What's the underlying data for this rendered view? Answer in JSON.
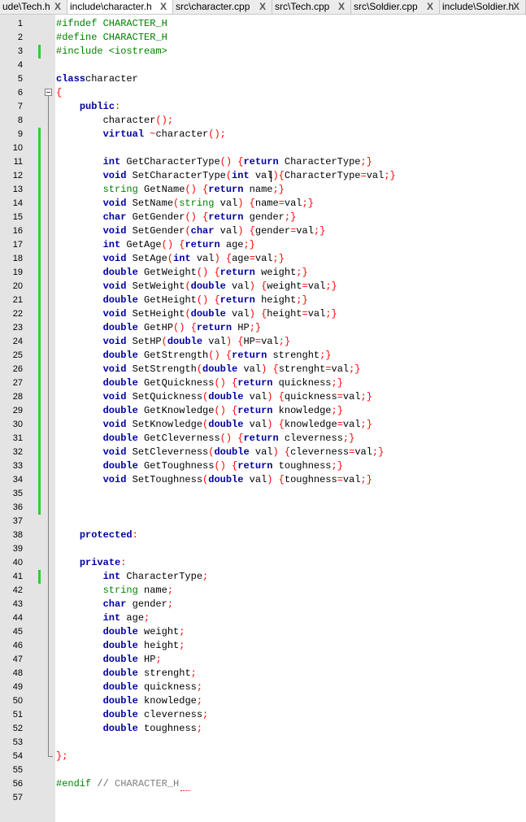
{
  "tabs": [
    {
      "label": "ude\\Tech.h",
      "active": false
    },
    {
      "label": "include\\character.h",
      "active": true
    },
    {
      "label": "src\\character.cpp",
      "active": false
    },
    {
      "label": "src\\Tech.cpp",
      "active": false
    },
    {
      "label": "src\\Soldier.cpp",
      "active": false
    },
    {
      "label": "include\\Soldier.h",
      "active": false
    }
  ],
  "tab_close_glyph": "X",
  "colors": {
    "keyword": "#0000a0",
    "type": "#008000",
    "preprocessor": "#008000",
    "brace": "#ff0000",
    "comment": "#808080",
    "change_marker": "#33cc33",
    "gutter_bg": "#e4e4e4"
  },
  "changed_lines": [
    3,
    9,
    10,
    11,
    12,
    13,
    14,
    15,
    16,
    17,
    18,
    19,
    20,
    21,
    22,
    23,
    24,
    25,
    26,
    27,
    28,
    29,
    30,
    31,
    32,
    33,
    34,
    35,
    36,
    41
  ],
  "lines": [
    {
      "n": "1",
      "tokens": [
        [
          "pre",
          "#ifndef CHARACTER_H"
        ]
      ]
    },
    {
      "n": "2",
      "tokens": [
        [
          "pre",
          "#define CHARACTER_H"
        ]
      ]
    },
    {
      "n": "3",
      "tokens": [
        [
          "pre",
          "#include <iostream>"
        ]
      ]
    },
    {
      "n": "4",
      "tokens": []
    },
    {
      "n": "5",
      "tokens": [
        [
          "kw",
          "class"
        ],
        [
          "",
          "character"
        ]
      ]
    },
    {
      "n": "6",
      "tokens": [
        [
          "br",
          "{"
        ]
      ]
    },
    {
      "n": "7",
      "tokens": [
        [
          "",
          "    "
        ],
        [
          "kw",
          "public"
        ],
        [
          "op",
          ":"
        ]
      ]
    },
    {
      "n": "8",
      "tokens": [
        [
          "",
          "        character"
        ],
        [
          "op",
          "();"
        ]
      ]
    },
    {
      "n": "9",
      "tokens": [
        [
          "",
          "        "
        ],
        [
          "kw",
          "virtual"
        ],
        [
          "op",
          " ~"
        ],
        [
          "",
          "character"
        ],
        [
          "op",
          "();"
        ]
      ]
    },
    {
      "n": "10",
      "tokens": []
    },
    {
      "n": "11",
      "tokens": [
        [
          "",
          "        "
        ],
        [
          "kw",
          "int"
        ],
        [
          "",
          " GetCharacterType"
        ],
        [
          "op",
          "() {"
        ],
        [
          "kw",
          "return"
        ],
        [
          "",
          " CharacterType"
        ],
        [
          "op",
          ";}"
        ]
      ]
    },
    {
      "n": "12",
      "tokens": [
        [
          "",
          "        "
        ],
        [
          "kw",
          "void"
        ],
        [
          "",
          " SetCharacterType"
        ],
        [
          "op",
          "("
        ],
        [
          "kw",
          "int"
        ],
        [
          "",
          " val"
        ],
        [
          "op",
          ")"
        ],
        [
          "op",
          "{"
        ],
        [
          "",
          "CharacterType"
        ],
        [
          "op",
          "="
        ],
        [
          "",
          "val"
        ],
        [
          "op",
          ";}"
        ]
      ]
    },
    {
      "n": "13",
      "tokens": [
        [
          "",
          "        "
        ],
        [
          "ty",
          "string"
        ],
        [
          "",
          " GetName"
        ],
        [
          "op",
          "() {"
        ],
        [
          "kw",
          "return"
        ],
        [
          "",
          " name"
        ],
        [
          "op",
          ";}"
        ]
      ]
    },
    {
      "n": "14",
      "tokens": [
        [
          "",
          "        "
        ],
        [
          "kw",
          "void"
        ],
        [
          "",
          " SetName"
        ],
        [
          "op",
          "("
        ],
        [
          "ty",
          "string"
        ],
        [
          "",
          " val"
        ],
        [
          "op",
          ") {"
        ],
        [
          "",
          "name"
        ],
        [
          "op",
          "="
        ],
        [
          "",
          "val"
        ],
        [
          "op",
          ";}"
        ]
      ]
    },
    {
      "n": "15",
      "tokens": [
        [
          "",
          "        "
        ],
        [
          "kw",
          "char"
        ],
        [
          "",
          " GetGender"
        ],
        [
          "op",
          "() {"
        ],
        [
          "kw",
          "return"
        ],
        [
          "",
          " gender"
        ],
        [
          "op",
          ";}"
        ]
      ]
    },
    {
      "n": "16",
      "tokens": [
        [
          "",
          "        "
        ],
        [
          "kw",
          "void"
        ],
        [
          "",
          " SetGender"
        ],
        [
          "op",
          "("
        ],
        [
          "kw",
          "char"
        ],
        [
          "",
          " val"
        ],
        [
          "op",
          ") {"
        ],
        [
          "",
          "gender"
        ],
        [
          "op",
          "="
        ],
        [
          "",
          "val"
        ],
        [
          "op",
          ";}"
        ]
      ]
    },
    {
      "n": "17",
      "tokens": [
        [
          "",
          "        "
        ],
        [
          "kw",
          "int"
        ],
        [
          "",
          " GetAge"
        ],
        [
          "op",
          "() {"
        ],
        [
          "kw",
          "return"
        ],
        [
          "",
          " age"
        ],
        [
          "op",
          ";}"
        ]
      ]
    },
    {
      "n": "18",
      "tokens": [
        [
          "",
          "        "
        ],
        [
          "kw",
          "void"
        ],
        [
          "",
          " SetAge"
        ],
        [
          "op",
          "("
        ],
        [
          "kw",
          "int"
        ],
        [
          "",
          " val"
        ],
        [
          "op",
          ") {"
        ],
        [
          "",
          "age"
        ],
        [
          "op",
          "="
        ],
        [
          "",
          "val"
        ],
        [
          "op",
          ";}"
        ]
      ]
    },
    {
      "n": "19",
      "tokens": [
        [
          "",
          "        "
        ],
        [
          "kw",
          "double"
        ],
        [
          "",
          " GetWeight"
        ],
        [
          "op",
          "() {"
        ],
        [
          "kw",
          "return"
        ],
        [
          "",
          " weight"
        ],
        [
          "op",
          ";}"
        ]
      ]
    },
    {
      "n": "20",
      "tokens": [
        [
          "",
          "        "
        ],
        [
          "kw",
          "void"
        ],
        [
          "",
          " SetWeight"
        ],
        [
          "op",
          "("
        ],
        [
          "kw",
          "double"
        ],
        [
          "",
          " val"
        ],
        [
          "op",
          ") {"
        ],
        [
          "",
          "weight"
        ],
        [
          "op",
          "="
        ],
        [
          "",
          "val"
        ],
        [
          "op",
          ";}"
        ]
      ]
    },
    {
      "n": "21",
      "tokens": [
        [
          "",
          "        "
        ],
        [
          "kw",
          "double"
        ],
        [
          "",
          " GetHeight"
        ],
        [
          "op",
          "() {"
        ],
        [
          "kw",
          "return"
        ],
        [
          "",
          " height"
        ],
        [
          "op",
          ";}"
        ]
      ]
    },
    {
      "n": "22",
      "tokens": [
        [
          "",
          "        "
        ],
        [
          "kw",
          "void"
        ],
        [
          "",
          " SetHeight"
        ],
        [
          "op",
          "("
        ],
        [
          "kw",
          "double"
        ],
        [
          "",
          " val"
        ],
        [
          "op",
          ") {"
        ],
        [
          "",
          "height"
        ],
        [
          "op",
          "="
        ],
        [
          "",
          "val"
        ],
        [
          "op",
          ";}"
        ]
      ]
    },
    {
      "n": "23",
      "tokens": [
        [
          "",
          "        "
        ],
        [
          "kw",
          "double"
        ],
        [
          "",
          " GetHP"
        ],
        [
          "op",
          "() {"
        ],
        [
          "kw",
          "return"
        ],
        [
          "",
          " HP"
        ],
        [
          "op",
          ";}"
        ]
      ]
    },
    {
      "n": "24",
      "tokens": [
        [
          "",
          "        "
        ],
        [
          "kw",
          "void"
        ],
        [
          "",
          " SetHP"
        ],
        [
          "op",
          "("
        ],
        [
          "kw",
          "double"
        ],
        [
          "",
          " val"
        ],
        [
          "op",
          ") {"
        ],
        [
          "",
          "HP"
        ],
        [
          "op",
          "="
        ],
        [
          "",
          "val"
        ],
        [
          "op",
          ";}"
        ]
      ]
    },
    {
      "n": "25",
      "tokens": [
        [
          "",
          "        "
        ],
        [
          "kw",
          "double"
        ],
        [
          "",
          " GetStrength"
        ],
        [
          "op",
          "() {"
        ],
        [
          "kw",
          "return"
        ],
        [
          "",
          " strenght"
        ],
        [
          "op",
          ";}"
        ]
      ]
    },
    {
      "n": "26",
      "tokens": [
        [
          "",
          "        "
        ],
        [
          "kw",
          "void"
        ],
        [
          "",
          " SetStrength"
        ],
        [
          "op",
          "("
        ],
        [
          "kw",
          "double"
        ],
        [
          "",
          " val"
        ],
        [
          "op",
          ") {"
        ],
        [
          "",
          "strenght"
        ],
        [
          "op",
          "="
        ],
        [
          "",
          "val"
        ],
        [
          "op",
          ";}"
        ]
      ]
    },
    {
      "n": "27",
      "tokens": [
        [
          "",
          "        "
        ],
        [
          "kw",
          "double"
        ],
        [
          "",
          " GetQuickness"
        ],
        [
          "op",
          "() {"
        ],
        [
          "kw",
          "return"
        ],
        [
          "",
          " quickness"
        ],
        [
          "op",
          ";}"
        ]
      ]
    },
    {
      "n": "28",
      "tokens": [
        [
          "",
          "        "
        ],
        [
          "kw",
          "void"
        ],
        [
          "",
          " SetQuickness"
        ],
        [
          "op",
          "("
        ],
        [
          "kw",
          "double"
        ],
        [
          "",
          " val"
        ],
        [
          "op",
          ") {"
        ],
        [
          "",
          "quickness"
        ],
        [
          "op",
          "="
        ],
        [
          "",
          "val"
        ],
        [
          "op",
          ";}"
        ]
      ]
    },
    {
      "n": "29",
      "tokens": [
        [
          "",
          "        "
        ],
        [
          "kw",
          "double"
        ],
        [
          "",
          " GetKnowledge"
        ],
        [
          "op",
          "() {"
        ],
        [
          "kw",
          "return"
        ],
        [
          "",
          " knowledge"
        ],
        [
          "op",
          ";}"
        ]
      ]
    },
    {
      "n": "30",
      "tokens": [
        [
          "",
          "        "
        ],
        [
          "kw",
          "void"
        ],
        [
          "",
          " SetKnowledge"
        ],
        [
          "op",
          "("
        ],
        [
          "kw",
          "double"
        ],
        [
          "",
          " val"
        ],
        [
          "op",
          ") {"
        ],
        [
          "",
          "knowledge"
        ],
        [
          "op",
          "="
        ],
        [
          "",
          "val"
        ],
        [
          "op",
          ";}"
        ]
      ]
    },
    {
      "n": "31",
      "tokens": [
        [
          "",
          "        "
        ],
        [
          "kw",
          "double"
        ],
        [
          "",
          " GetCleverness"
        ],
        [
          "op",
          "() {"
        ],
        [
          "kw",
          "return"
        ],
        [
          "",
          " cleverness"
        ],
        [
          "op",
          ";}"
        ]
      ]
    },
    {
      "n": "32",
      "tokens": [
        [
          "",
          "        "
        ],
        [
          "kw",
          "void"
        ],
        [
          "",
          " SetCleverness"
        ],
        [
          "op",
          "("
        ],
        [
          "kw",
          "double"
        ],
        [
          "",
          " val"
        ],
        [
          "op",
          ") {"
        ],
        [
          "",
          "cleverness"
        ],
        [
          "op",
          "="
        ],
        [
          "",
          "val"
        ],
        [
          "op",
          ";}"
        ]
      ]
    },
    {
      "n": "33",
      "tokens": [
        [
          "",
          "        "
        ],
        [
          "kw",
          "double"
        ],
        [
          "",
          " GetToughness"
        ],
        [
          "op",
          "() {"
        ],
        [
          "kw",
          "return"
        ],
        [
          "",
          " toughness"
        ],
        [
          "op",
          ";}"
        ]
      ]
    },
    {
      "n": "34",
      "tokens": [
        [
          "",
          "        "
        ],
        [
          "kw",
          "void"
        ],
        [
          "",
          " SetToughness"
        ],
        [
          "op",
          "("
        ],
        [
          "kw",
          "double"
        ],
        [
          "",
          " val"
        ],
        [
          "op",
          ") {"
        ],
        [
          "",
          "toughness"
        ],
        [
          "op",
          "="
        ],
        [
          "",
          "val"
        ],
        [
          "op",
          ";}"
        ]
      ]
    },
    {
      "n": "35",
      "tokens": []
    },
    {
      "n": "36",
      "tokens": []
    },
    {
      "n": "37",
      "tokens": []
    },
    {
      "n": "38",
      "tokens": [
        [
          "",
          "    "
        ],
        [
          "kw",
          "protected"
        ],
        [
          "op",
          ":"
        ]
      ]
    },
    {
      "n": "39",
      "tokens": []
    },
    {
      "n": "40",
      "tokens": [
        [
          "",
          "    "
        ],
        [
          "kw",
          "private"
        ],
        [
          "op",
          ":"
        ]
      ]
    },
    {
      "n": "41",
      "tokens": [
        [
          "",
          "        "
        ],
        [
          "kw",
          "int"
        ],
        [
          "",
          " CharacterType"
        ],
        [
          "op",
          ";"
        ]
      ]
    },
    {
      "n": "42",
      "tokens": [
        [
          "",
          "        "
        ],
        [
          "ty",
          "string"
        ],
        [
          "",
          " name"
        ],
        [
          "op",
          ";"
        ]
      ]
    },
    {
      "n": "43",
      "tokens": [
        [
          "",
          "        "
        ],
        [
          "kw",
          "char"
        ],
        [
          "",
          " gender"
        ],
        [
          "op",
          ";"
        ]
      ]
    },
    {
      "n": "44",
      "tokens": [
        [
          "",
          "        "
        ],
        [
          "kw",
          "int"
        ],
        [
          "",
          " age"
        ],
        [
          "op",
          ";"
        ]
      ]
    },
    {
      "n": "45",
      "tokens": [
        [
          "",
          "        "
        ],
        [
          "kw",
          "double"
        ],
        [
          "",
          " weight"
        ],
        [
          "op",
          ";"
        ]
      ]
    },
    {
      "n": "46",
      "tokens": [
        [
          "",
          "        "
        ],
        [
          "kw",
          "double"
        ],
        [
          "",
          " height"
        ],
        [
          "op",
          ";"
        ]
      ]
    },
    {
      "n": "47",
      "tokens": [
        [
          "",
          "        "
        ],
        [
          "kw",
          "double"
        ],
        [
          "",
          " HP"
        ],
        [
          "op",
          ";"
        ]
      ]
    },
    {
      "n": "48",
      "tokens": [
        [
          "",
          "        "
        ],
        [
          "kw",
          "double"
        ],
        [
          "",
          " strenght"
        ],
        [
          "op",
          ";"
        ]
      ]
    },
    {
      "n": "49",
      "tokens": [
        [
          "",
          "        "
        ],
        [
          "kw",
          "double"
        ],
        [
          "",
          " quickness"
        ],
        [
          "op",
          ";"
        ]
      ]
    },
    {
      "n": "50",
      "tokens": [
        [
          "",
          "        "
        ],
        [
          "kw",
          "double"
        ],
        [
          "",
          " knowledge"
        ],
        [
          "op",
          ";"
        ]
      ]
    },
    {
      "n": "51",
      "tokens": [
        [
          "",
          "        "
        ],
        [
          "kw",
          "double"
        ],
        [
          "",
          " cleverness"
        ],
        [
          "op",
          ";"
        ]
      ]
    },
    {
      "n": "52",
      "tokens": [
        [
          "",
          "        "
        ],
        [
          "kw",
          "double"
        ],
        [
          "",
          " toughness"
        ],
        [
          "op",
          ";"
        ]
      ]
    },
    {
      "n": "53",
      "tokens": []
    },
    {
      "n": "54",
      "tokens": [
        [
          "br",
          "};"
        ]
      ]
    },
    {
      "n": "55",
      "tokens": []
    },
    {
      "n": "56",
      "tokens": [
        [
          "pre",
          "#endif"
        ],
        [
          "cm",
          " // "
        ],
        [
          "cmu",
          "CHARACTER_H"
        ]
      ]
    },
    {
      "n": "57",
      "tokens": []
    }
  ]
}
